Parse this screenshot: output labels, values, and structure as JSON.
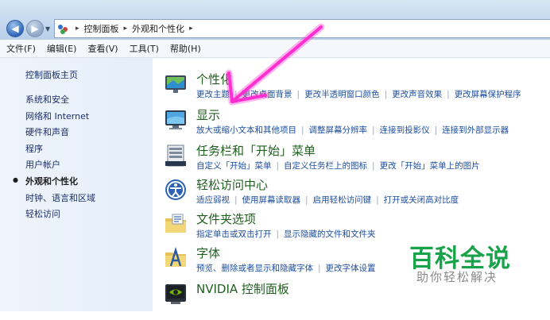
{
  "address_bar": {
    "back_label": "◀",
    "forward_label": "▶",
    "dropdown": "▼",
    "separator": "▸",
    "breadcrumbs": [
      "控制面板",
      "外观和个性化"
    ]
  },
  "menu": [
    "文件(F)",
    "编辑(E)",
    "查看(V)",
    "工具(T)",
    "帮助(H)"
  ],
  "sidebar": {
    "home": "控制面板主页",
    "items": [
      {
        "label": "系统和安全",
        "active": false
      },
      {
        "label": "网络和 Internet",
        "active": false
      },
      {
        "label": "硬件和声音",
        "active": false
      },
      {
        "label": "程序",
        "active": false
      },
      {
        "label": "用户帐户",
        "active": false
      },
      {
        "label": "外观和个性化",
        "active": true
      },
      {
        "label": "时钟、语言和区域",
        "active": false
      },
      {
        "label": "轻松访问",
        "active": false
      }
    ]
  },
  "categories": [
    {
      "title": "个性化",
      "icon": "personalization-icon",
      "links": [
        "更改主题",
        "更改桌面背景",
        "更改半透明窗口颜色",
        "更改声音效果",
        "更改屏幕保护程序"
      ]
    },
    {
      "title": "显示",
      "icon": "display-icon",
      "links": [
        "放大或缩小文本和其他项目",
        "调整屏幕分辨率",
        "连接到投影仪",
        "连接到外部显示器"
      ]
    },
    {
      "title": "任务栏和「开始」菜单",
      "icon": "taskbar-icon",
      "links": [
        "自定义「开始」菜单",
        "自定义任务栏上的图标",
        "更改「开始」菜单上的图片"
      ]
    },
    {
      "title": "轻松访问中心",
      "icon": "ease-of-access-icon",
      "links": [
        "适应弱视",
        "使用屏幕读取器",
        "启用轻松访问键",
        "打开或关闭高对比度"
      ]
    },
    {
      "title": "文件夹选项",
      "icon": "folder-options-icon",
      "links": [
        "指定单击或双击打开",
        "显示隐藏的文件和文件夹"
      ]
    },
    {
      "title": "字体",
      "icon": "fonts-icon",
      "links": [
        "预览、删除或者显示和隐藏字体",
        "更改字体设置"
      ]
    },
    {
      "title": "NVIDIA 控制面板",
      "icon": "nvidia-icon",
      "links": []
    }
  ],
  "watermark": {
    "title": "百科全说",
    "subtitle": "助你轻松解决"
  },
  "colors": {
    "link": "#1c4d9e",
    "category_title": "#1e5f1e",
    "arrow": "#ff2ed0",
    "watermark": "#1aa24a"
  }
}
